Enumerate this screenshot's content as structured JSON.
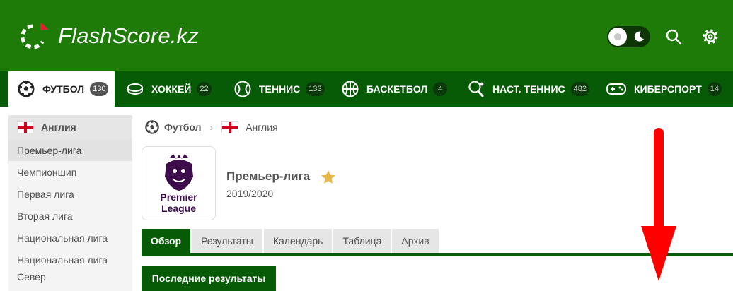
{
  "header": {
    "brand": "FlashScore.kz",
    "icons": [
      "flashscore-logo-icon",
      "sun-icon",
      "moon-icon",
      "search-icon",
      "gear-icon"
    ]
  },
  "sports": [
    {
      "label": "ФУТБОЛ",
      "count": "130",
      "icon": "soccer-ball-icon",
      "active": true
    },
    {
      "label": "ХОККЕЙ",
      "count": "22",
      "icon": "hockey-puck-icon"
    },
    {
      "label": "ТЕННИС",
      "count": "133",
      "icon": "tennis-ball-icon"
    },
    {
      "label": "БАСКЕТБОЛ",
      "count": "4",
      "icon": "basketball-icon"
    },
    {
      "label": "НАСТ. ТЕННИС",
      "count": "482",
      "icon": "table-tennis-icon"
    },
    {
      "label": "КИБЕРСПОРТ",
      "count": "14",
      "icon": "gamepad-icon"
    }
  ],
  "sidebar": {
    "country": "Англия",
    "leagues": [
      {
        "label": "Премьер-лига",
        "selected": true
      },
      {
        "label": "Чемпионшип"
      },
      {
        "label": "Первая лига"
      },
      {
        "label": "Вторая лига"
      },
      {
        "label": "Национальная лига"
      },
      {
        "label": "Национальная лига Север"
      }
    ]
  },
  "breadcrumb": {
    "sport": "Футбол",
    "country": "Англия"
  },
  "league": {
    "logo_line1": "Premier",
    "logo_line2": "League",
    "title": "Премьер-лига",
    "season": "2019/2020"
  },
  "tabs": [
    {
      "label": "Обзор",
      "active": true
    },
    {
      "label": "Результаты"
    },
    {
      "label": "Календарь"
    },
    {
      "label": "Таблица"
    },
    {
      "label": "Архив"
    }
  ],
  "section": {
    "latest_results": "Последние результаты"
  },
  "colors": {
    "header_green": "#1e7b08",
    "dark_green": "#075b07",
    "annotation_red": "#ff0000",
    "star": "#e9b84a",
    "pl_purple": "#3d0c4a"
  }
}
